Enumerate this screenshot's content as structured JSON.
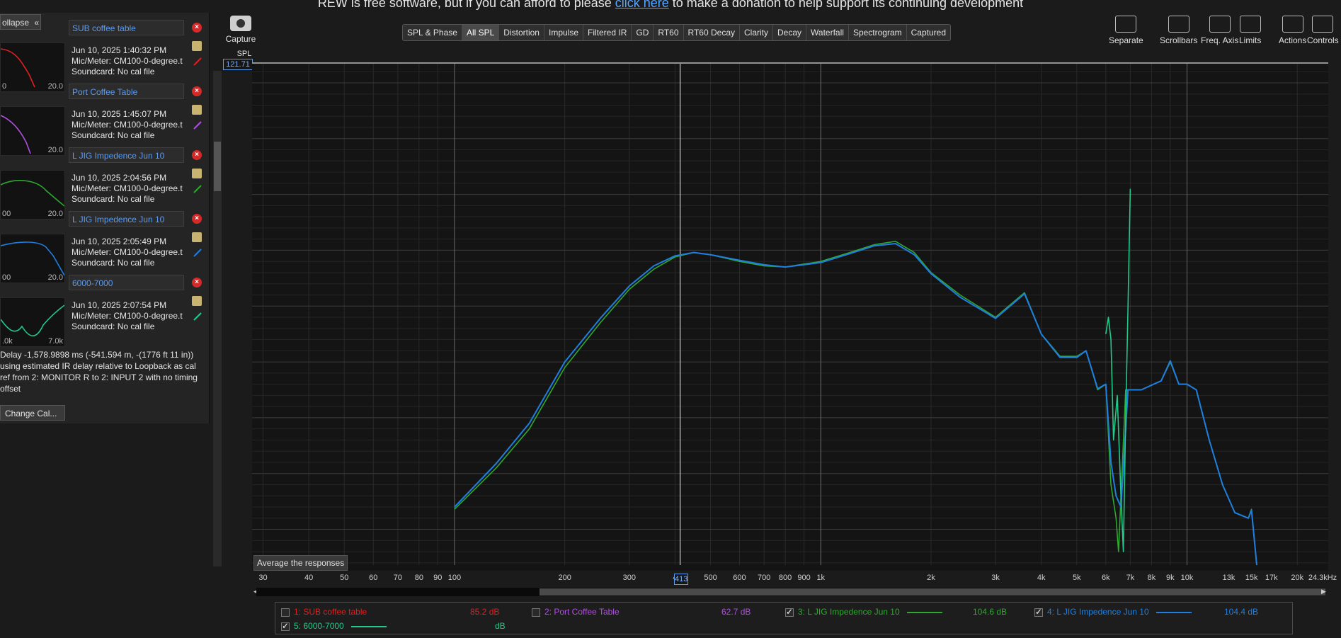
{
  "banner": {
    "prefix": "REW is free software, but if you can afford to please ",
    "link": "click here",
    "suffix": " to make a donation to help support its continuing development"
  },
  "sidebar": {
    "collapse_label": "ollapse",
    "collapse_icon": "double-chevron-left-icon",
    "measurements": [
      {
        "name": "SUB coffee table",
        "datetime": "Jun 10, 2025 1:40:32 PM",
        "mic": "Mic/Meter: CM100-0-degree.t",
        "soundcard": "Soundcard: No cal file",
        "color": "#e02020",
        "thumb_left": "0",
        "thumb_right": "20.0"
      },
      {
        "name": "Port Coffee Table",
        "datetime": "Jun 10, 2025 1:45:07 PM",
        "mic": "Mic/Meter: CM100-0-degree.t",
        "soundcard": "Soundcard: No cal file",
        "color": "#b050e0",
        "thumb_left": "",
        "thumb_right": "20.0"
      },
      {
        "name": "L JIG Impedence Jun 10",
        "datetime": "Jun 10, 2025 2:04:56 PM",
        "mic": "Mic/Meter: CM100-0-degree.t",
        "soundcard": "Soundcard: No cal file",
        "color": "#2ea82e",
        "thumb_left": "00",
        "thumb_right": "20.0"
      },
      {
        "name": "L JIG Impedence Jun 10",
        "datetime": "Jun 10, 2025 2:05:49 PM",
        "mic": "Mic/Meter: CM100-0-degree.t",
        "soundcard": "Soundcard: No cal file",
        "color": "#1f7fe0",
        "thumb_left": "00",
        "thumb_right": "20.0"
      },
      {
        "name": "6000-7000",
        "datetime": "Jun 10, 2025 2:07:54 PM",
        "mic": "Mic/Meter: CM100-0-degree.t",
        "soundcard": "Soundcard: No cal file",
        "color": "#22c98a",
        "thumb_left": ".0k",
        "thumb_right": "7.0k"
      }
    ],
    "cal_note": "Delay -1,578.9898 ms (-541.594 m, -(1776 ft 11 in)) using estimated IR delay relative to Loopback as cal ref from 2: MONITOR R to 2: INPUT 2 with no timing offset",
    "change_cal_label": "Change Cal..."
  },
  "toolbar": {
    "capture_label": "Capture",
    "capture_icon": "camera-icon",
    "tabs": [
      "SPL & Phase",
      "All SPL",
      "Distortion",
      "Impulse",
      "Filtered IR",
      "GD",
      "RT60",
      "RT60 Decay",
      "Clarity",
      "Decay",
      "Waterfall",
      "Spectrogram",
      "Captured"
    ],
    "active_tab": "All SPL",
    "right_tools": [
      {
        "label": "Separate",
        "icon": "separate-icon"
      },
      {
        "label": "Scrollbars",
        "icon": "scrollbars-icon"
      },
      {
        "label": "Freq. Axis",
        "icon": "freq-axis-icon"
      },
      {
        "label": "Limits",
        "icon": "limits-icon"
      },
      {
        "label": "Actions",
        "icon": "actions-icon"
      },
      {
        "label": "Controls",
        "icon": "gear-icon"
      }
    ]
  },
  "graph": {
    "y_axis_label": "SPL",
    "y_max_display": "121.71",
    "cursor_freq": "413",
    "average_button_label": "Average the responses"
  },
  "chart_data": {
    "type": "line",
    "title": "",
    "xlabel": "",
    "ylabel": "SPL",
    "x_scale": "log",
    "xlim": [
      28,
      24300
    ],
    "ylim": [
      76.8,
      121.71
    ],
    "grid": true,
    "y_ticks": [
      80,
      85,
      90,
      95,
      100,
      105,
      110,
      115,
      120
    ],
    "x_ticks": [
      {
        "v": 30,
        "label": "30"
      },
      {
        "v": 40,
        "label": "40"
      },
      {
        "v": 50,
        "label": "50"
      },
      {
        "v": 60,
        "label": "60"
      },
      {
        "v": 70,
        "label": "70"
      },
      {
        "v": 80,
        "label": "80"
      },
      {
        "v": 90,
        "label": "90"
      },
      {
        "v": 100,
        "label": "100"
      },
      {
        "v": 200,
        "label": "200"
      },
      {
        "v": 300,
        "label": "300"
      },
      {
        "v": 400,
        "label": "4"
      },
      {
        "v": 500,
        "label": "500"
      },
      {
        "v": 600,
        "label": "600"
      },
      {
        "v": 700,
        "label": "700"
      },
      {
        "v": 800,
        "label": "800"
      },
      {
        "v": 900,
        "label": "900"
      },
      {
        "v": 1000,
        "label": "1k"
      },
      {
        "v": 2000,
        "label": "2k"
      },
      {
        "v": 3000,
        "label": "3k"
      },
      {
        "v": 4000,
        "label": "4k"
      },
      {
        "v": 5000,
        "label": "5k"
      },
      {
        "v": 6000,
        "label": "6k"
      },
      {
        "v": 7000,
        "label": "7k"
      },
      {
        "v": 8000,
        "label": "8k"
      },
      {
        "v": 9000,
        "label": "9k"
      },
      {
        "v": 10000,
        "label": "10k"
      },
      {
        "v": 13000,
        "label": "13k"
      },
      {
        "v": 15000,
        "label": "15k"
      },
      {
        "v": 17000,
        "label": "17k"
      },
      {
        "v": 20000,
        "label": "20k"
      },
      {
        "v": 24300,
        "label": "24.3kHz"
      }
    ],
    "series": [
      {
        "name": "3: L JIG Impedence Jun 10",
        "color": "#2ea82e",
        "points": [
          [
            100,
            81.8
          ],
          [
            130,
            85.5
          ],
          [
            160,
            89
          ],
          [
            200,
            94.5
          ],
          [
            250,
            98.5
          ],
          [
            300,
            101.5
          ],
          [
            350,
            103.3
          ],
          [
            400,
            104.4
          ],
          [
            450,
            104.8
          ],
          [
            500,
            104.6
          ],
          [
            600,
            104
          ],
          [
            700,
            103.6
          ],
          [
            800,
            103.5
          ],
          [
            1000,
            104
          ],
          [
            1200,
            104.8
          ],
          [
            1400,
            105.5
          ],
          [
            1600,
            105.8
          ],
          [
            1800,
            104.8
          ],
          [
            2000,
            103
          ],
          [
            2400,
            101
          ],
          [
            3000,
            99
          ],
          [
            3600,
            101.2
          ],
          [
            4000,
            97.5
          ],
          [
            4500,
            95.5
          ],
          [
            5000,
            95.5
          ],
          [
            5300,
            96
          ],
          [
            5700,
            92.5
          ],
          [
            6000,
            93
          ],
          [
            6200,
            84
          ],
          [
            6400,
            81
          ],
          [
            6500,
            78
          ],
          [
            6800,
            92.5
          ],
          [
            7500,
            92.5
          ],
          [
            8500,
            93.3
          ],
          [
            9000,
            95
          ],
          [
            9500,
            93
          ],
          [
            10000,
            93
          ],
          [
            10600,
            92.5
          ],
          [
            11500,
            88
          ],
          [
            12500,
            84
          ],
          [
            13500,
            81.5
          ],
          [
            14700,
            81
          ],
          [
            15000,
            81.8
          ],
          [
            15500,
            76.8
          ]
        ]
      },
      {
        "name": "4: L JIG Impedence Jun 10",
        "color": "#1f7fe0",
        "points": [
          [
            100,
            82
          ],
          [
            130,
            85.9
          ],
          [
            160,
            89.5
          ],
          [
            200,
            95.0
          ],
          [
            250,
            98.9
          ],
          [
            300,
            101.8
          ],
          [
            350,
            103.6
          ],
          [
            400,
            104.5
          ],
          [
            450,
            104.8
          ],
          [
            500,
            104.6
          ],
          [
            600,
            104.1
          ],
          [
            700,
            103.7
          ],
          [
            800,
            103.5
          ],
          [
            1000,
            103.9
          ],
          [
            1200,
            104.7
          ],
          [
            1400,
            105.4
          ],
          [
            1600,
            105.6
          ],
          [
            1800,
            104.6
          ],
          [
            2000,
            102.9
          ],
          [
            2400,
            100.8
          ],
          [
            3000,
            98.9
          ],
          [
            3600,
            101.1
          ],
          [
            4000,
            97.5
          ],
          [
            4500,
            95.4
          ],
          [
            5000,
            95.4
          ],
          [
            5300,
            96
          ],
          [
            5700,
            92.6
          ],
          [
            6000,
            93
          ],
          [
            6200,
            86
          ],
          [
            6400,
            83
          ],
          [
            6600,
            82
          ],
          [
            6900,
            92.5
          ],
          [
            7500,
            92.5
          ],
          [
            8500,
            93.3
          ],
          [
            9000,
            95.1
          ],
          [
            9500,
            93
          ],
          [
            10000,
            93
          ],
          [
            10600,
            92.5
          ],
          [
            11500,
            88
          ],
          [
            12500,
            84
          ],
          [
            13500,
            81.5
          ],
          [
            14700,
            81
          ],
          [
            15000,
            81.7
          ],
          [
            15500,
            76.8
          ]
        ]
      },
      {
        "name": "5: 6000-7000",
        "color": "#22c98a",
        "points": [
          [
            6000,
            97.5
          ],
          [
            6100,
            99
          ],
          [
            6200,
            97
          ],
          [
            6300,
            88
          ],
          [
            6450,
            92
          ],
          [
            6600,
            83
          ],
          [
            6700,
            78
          ],
          [
            6800,
            90
          ],
          [
            6900,
            100
          ],
          [
            7000,
            110.5
          ]
        ]
      }
    ]
  },
  "legend": [
    {
      "label": "1: SUB coffee table",
      "color": "#e02020",
      "checked": false,
      "value": "85.2 dB",
      "show_line": false
    },
    {
      "label": "2: Port Coffee Table",
      "color": "#b050e0",
      "checked": false,
      "value": "62.7 dB",
      "show_line": false
    },
    {
      "label": "3: L JIG Impedence Jun 10",
      "color": "#2ea82e",
      "checked": true,
      "value": "104.6 dB",
      "show_line": true
    },
    {
      "label": "4: L JIG Impedence Jun 10",
      "color": "#1f7fe0",
      "checked": true,
      "value": "104.4 dB",
      "show_line": true
    },
    {
      "label": "5: 6000-7000",
      "color": "#22c98a",
      "checked": true,
      "value": "dB",
      "show_line": true
    }
  ]
}
